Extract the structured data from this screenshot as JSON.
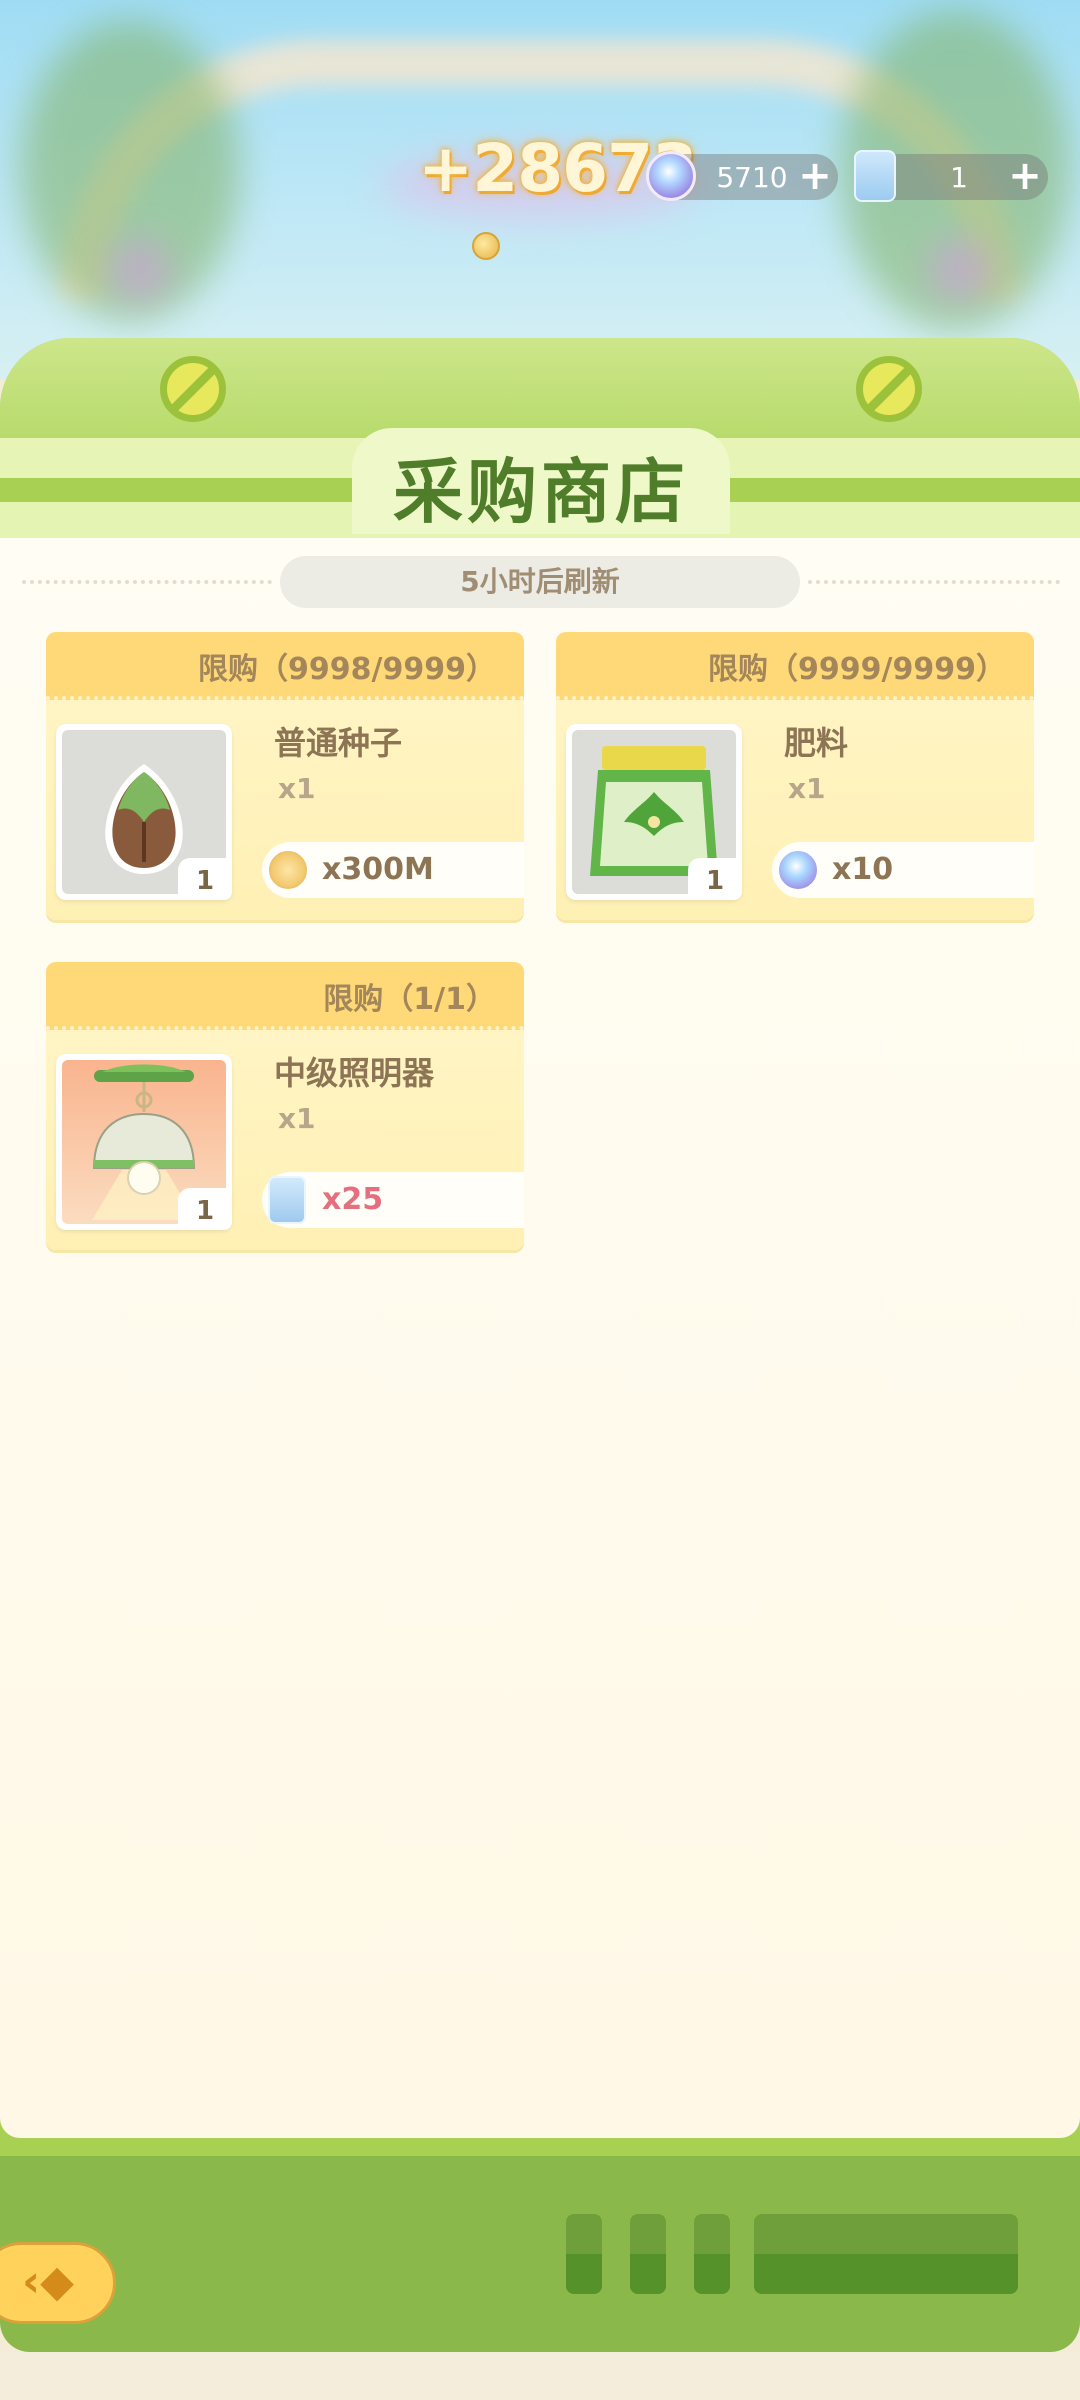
{
  "hud": {
    "gain_popup": "+28673",
    "gems": "5710",
    "tickets": "1"
  },
  "shop": {
    "title": "采购商店",
    "refresh_text": "5小时后刷新",
    "items": [
      {
        "limit": "限购（9998/9999）",
        "name": "普通种子",
        "qty": "x1",
        "stack": "1",
        "price": "x300M",
        "currency": "coin-icon"
      },
      {
        "limit": "限购（9999/9999）",
        "name": "肥料",
        "qty": "x1",
        "stack": "1",
        "price": "x10",
        "currency": "gem-icon"
      },
      {
        "limit": "限购（1/1）",
        "name": "中级照明器",
        "qty": "x1",
        "stack": "1",
        "price": "x25",
        "currency": "ticket-bag-icon"
      }
    ]
  },
  "colors": {
    "panel_green": "#a8d153",
    "title_green": "#4f7d2a",
    "card_header": "#ffd978",
    "price_red": "#e46f7e"
  }
}
